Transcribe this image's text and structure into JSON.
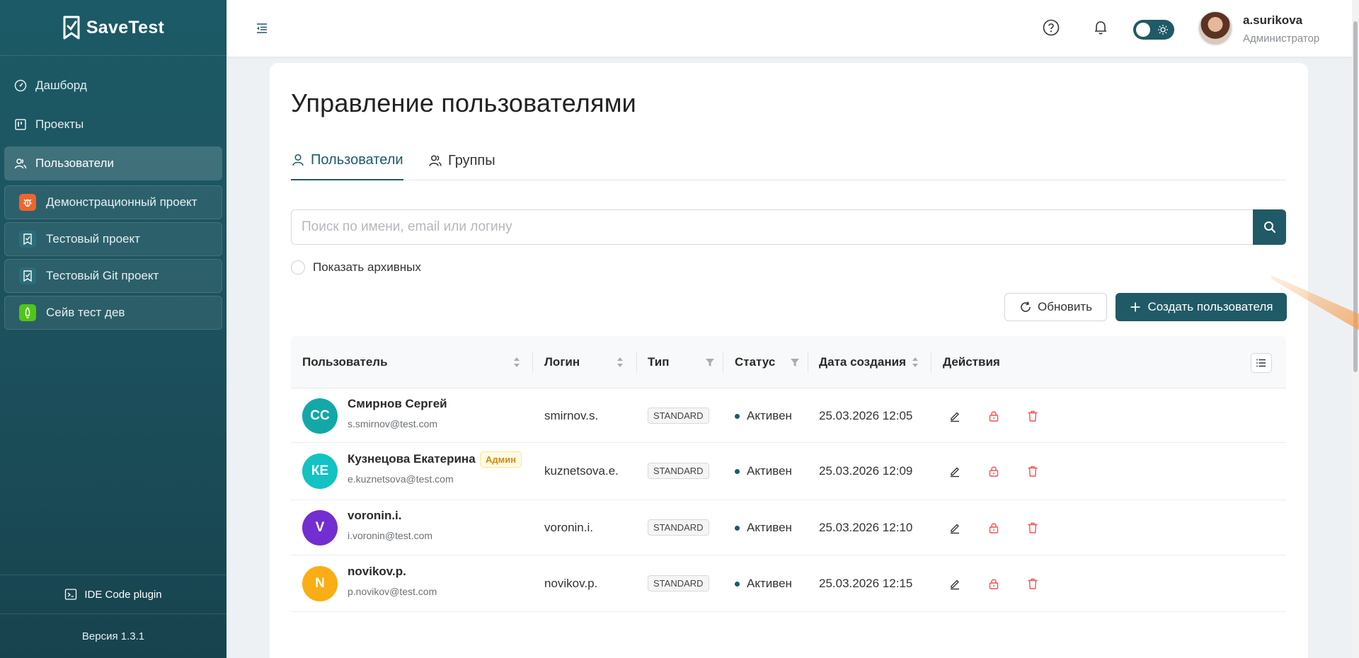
{
  "app": {
    "name": "SaveTest",
    "version": "Версия 1.3.1",
    "plugin_label": "IDE Code plugin"
  },
  "sidebar": {
    "items": [
      {
        "label": "Дашборд",
        "icon": "dashboard-icon"
      },
      {
        "label": "Проекты",
        "icon": "projects-icon"
      },
      {
        "label": "Пользователи",
        "icon": "users-icon",
        "active": true
      }
    ],
    "projects": [
      {
        "label": "Демонстрационный проект",
        "icon": "bug-icon",
        "color": "#f0642d"
      },
      {
        "label": "Тестовый проект",
        "icon": "checklist-icon",
        "color": "#2c6d79"
      },
      {
        "label": "Тестовый Git проект",
        "icon": "checklist-icon",
        "color": "#2c6d79"
      },
      {
        "label": "Сейв тест дев",
        "icon": "rocket-icon",
        "color": "#52c41a"
      }
    ]
  },
  "header": {
    "user_name": "a.surikova",
    "user_role": "Администратор"
  },
  "page": {
    "title": "Управление пользователями",
    "tabs": [
      {
        "label": "Пользователи"
      },
      {
        "label": "Группы"
      }
    ],
    "search_placeholder": "Поиск по имени, email или логину",
    "archive_label": "Показать архивных",
    "refresh_label": "Обновить",
    "create_label": "Создать пользователя"
  },
  "table": {
    "columns": [
      "Пользователь",
      "Логин",
      "Тип",
      "Статус",
      "Дата создания",
      "Действия"
    ],
    "rows": [
      {
        "initials": "СС",
        "avatar_color": "#13a8a8",
        "name": "Смирнов Сергей",
        "email": "s.smirnov@test.com",
        "admin": "",
        "login": "smirnov.s.",
        "type": "STANDARD",
        "status": "Активен",
        "created": "25.03.2026 12:05"
      },
      {
        "initials": "КЕ",
        "avatar_color": "#13c2c2",
        "name": "Кузнецова Екатерина",
        "email": "e.kuznetsova@test.com",
        "admin": "Админ",
        "login": "kuznetsova.e.",
        "type": "STANDARD",
        "status": "Активен",
        "created": "25.03.2026 12:09"
      },
      {
        "initials": "V",
        "avatar_color": "#722ed1",
        "name": "voronin.i.",
        "email": "i.voronin@test.com",
        "admin": "",
        "login": "voronin.i.",
        "type": "STANDARD",
        "status": "Активен",
        "created": "25.03.2026 12:10"
      },
      {
        "initials": "N",
        "avatar_color": "#faad14",
        "name": "novikov.p.",
        "email": "p.novikov@test.com",
        "admin": "",
        "login": "novikov.p.",
        "type": "STANDARD",
        "status": "Активен",
        "created": "25.03.2026 12:15"
      }
    ]
  },
  "colors": {
    "primary": "#1f5a66",
    "danger": "#ff4d4f",
    "arrow": "#f5a050"
  }
}
